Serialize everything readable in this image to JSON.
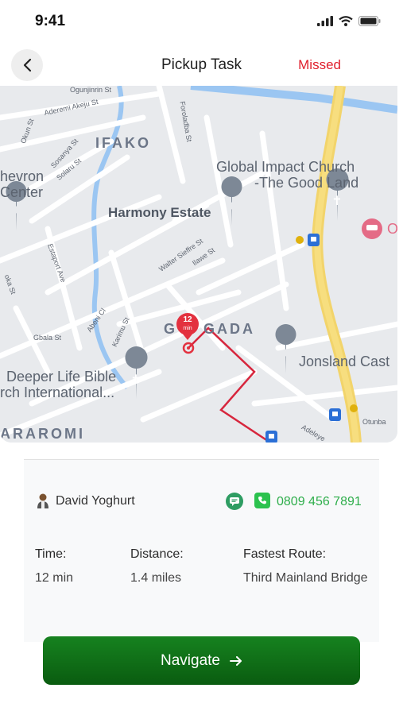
{
  "status_bar": {
    "time": "9:41",
    "icons": [
      "signal-icon",
      "wifi-icon",
      "battery-icon"
    ]
  },
  "header": {
    "back_icon": "chevron-left-icon",
    "title": "Pickup Task",
    "status": "Missed"
  },
  "map": {
    "area_labels": [
      "IFAKO",
      "G",
      "GADA",
      "ARAROMI"
    ],
    "pois": [
      "Global Impact Church",
      "-The Good Land",
      "Harmony Estate",
      "Jonsland Cast",
      "Deeper Life Bible",
      "rch International...",
      "hevron",
      "Center"
    ],
    "streets": [
      "Ogunjinrin St",
      "Aderemi Akeju St",
      "Okun St",
      "Sosanya St",
      "Solaru St",
      "Foroladba St",
      "Walter Sieffre St",
      "Ilawe St",
      "Estaport Ave",
      "Abeni Cl",
      "Karimu St",
      "Gbala St",
      "oka St",
      "Otunba",
      "Adeleye"
    ],
    "marker_eta_value": "12",
    "marker_eta_unit": "min",
    "partial_poi": "O"
  },
  "driver": {
    "name": "David Yoghurt",
    "phone": "0809 456 7891",
    "chat_icon": "chat-bubble-icon",
    "whatsapp_icon": "whatsapp-icon"
  },
  "trip": {
    "time_label": "Time:",
    "time_value": "12 min",
    "distance_label": "Distance:",
    "distance_value": "1.4 miles",
    "route_label": "Fastest Route:",
    "route_value": "Third Mainland Bridge"
  },
  "navigate": {
    "label": "Navigate",
    "icon": "arrow-right-icon"
  },
  "colors": {
    "missed": "#e0202e",
    "brand_green": "#0e6e16",
    "phone_green": "#2eae4b",
    "route_red": "#d7263d"
  }
}
